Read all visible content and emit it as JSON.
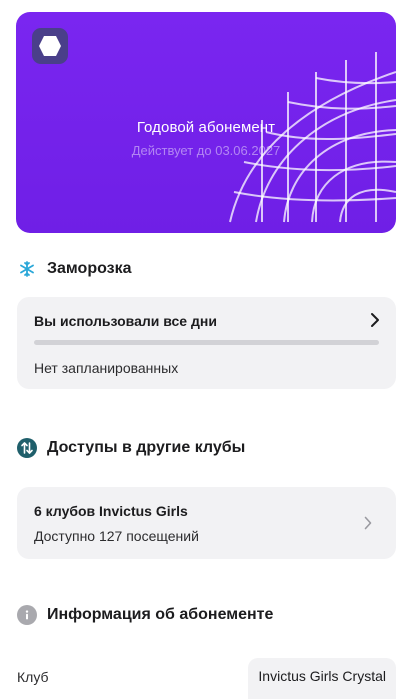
{
  "card": {
    "title": "Годовой абонемент",
    "subtitle": "Действует до 03.06.2027",
    "logo_icon": "hexagon-logo-icon",
    "colors": {
      "background": "#7421ec",
      "lines": "#ffffff"
    }
  },
  "freeze": {
    "heading": "Заморозка",
    "icon": "snowflake-icon",
    "title": "Вы использовали все дни",
    "used_fraction": 1.0,
    "status": "Нет запланированных"
  },
  "access": {
    "heading": "Доступы в другие клубы",
    "icon": "swap-arrows-icon",
    "title": "6 клубов Invictus Girls",
    "visits": "Доступно 127 посещений"
  },
  "info": {
    "heading": "Информация об абонементе",
    "icon": "info-icon",
    "club_label": "Клуб",
    "club_value": "Invictus Girls Crystal"
  }
}
